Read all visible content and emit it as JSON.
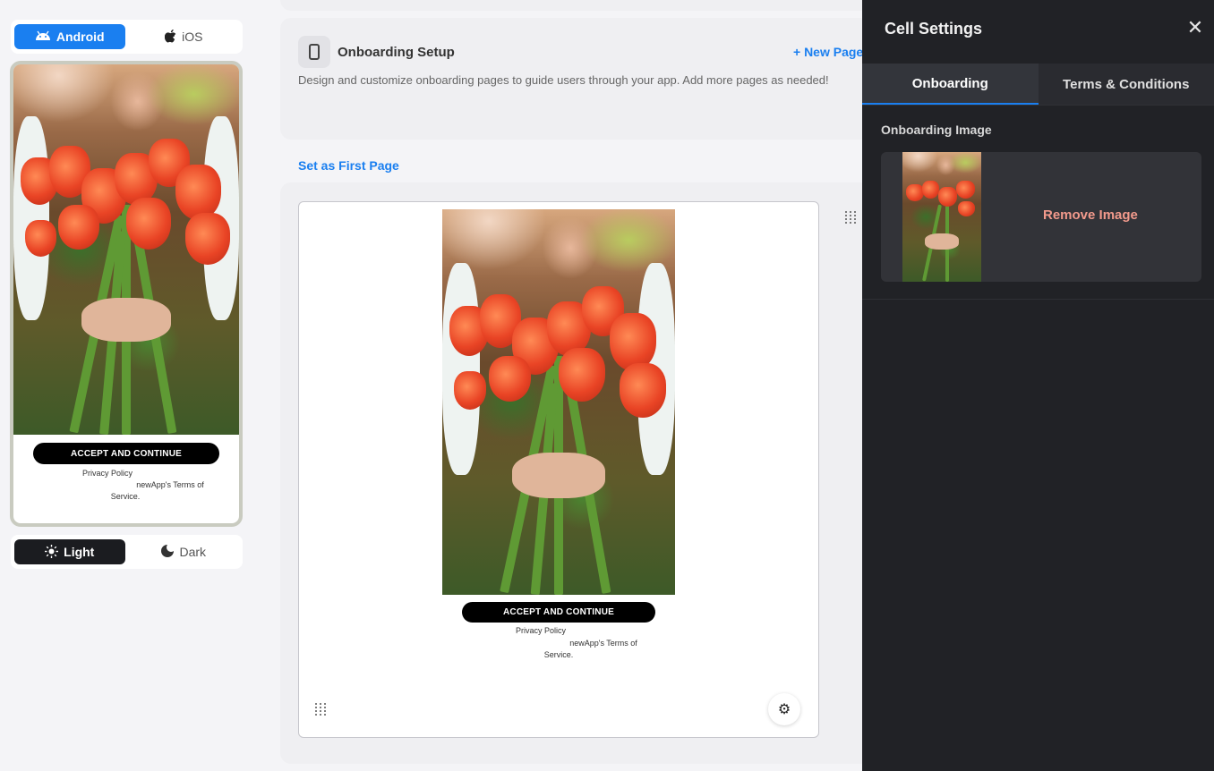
{
  "preview": {
    "platform_tabs": [
      {
        "label": "Android",
        "icon": "android-icon",
        "active": true
      },
      {
        "label": "iOS",
        "icon": "apple-icon",
        "active": false
      }
    ],
    "theme_tabs": [
      {
        "label": "Light",
        "icon": "sun-icon",
        "active": true
      },
      {
        "label": "Dark",
        "icon": "moon-icon",
        "active": false
      }
    ],
    "accept_label": "ACCEPT AND CONTINUE",
    "legal_line1": "Privacy Policy",
    "legal_line2": "newApp's Terms of",
    "legal_line3": "Service."
  },
  "setup": {
    "title": "Onboarding Setup",
    "new_page_label": "+ New Page",
    "description": "Design and customize onboarding pages to guide users through your app. Add more pages as needed!"
  },
  "set_first_page_label": "Set as First Page",
  "cell": {
    "accept_label": "ACCEPT AND CONTINUE",
    "legal_line1": "Privacy Policy",
    "legal_line2": "newApp's Terms of",
    "legal_line3": "Service."
  },
  "settings": {
    "title": "Cell Settings",
    "tabs": [
      {
        "label": "Onboarding",
        "active": true
      },
      {
        "label": "Terms & Conditions",
        "active": false
      }
    ],
    "section_label": "Onboarding Image",
    "remove_label": "Remove Image"
  },
  "colors": {
    "accent": "#1a7ff0",
    "panel_bg": "#212226",
    "remove_text": "#f29a8c"
  }
}
